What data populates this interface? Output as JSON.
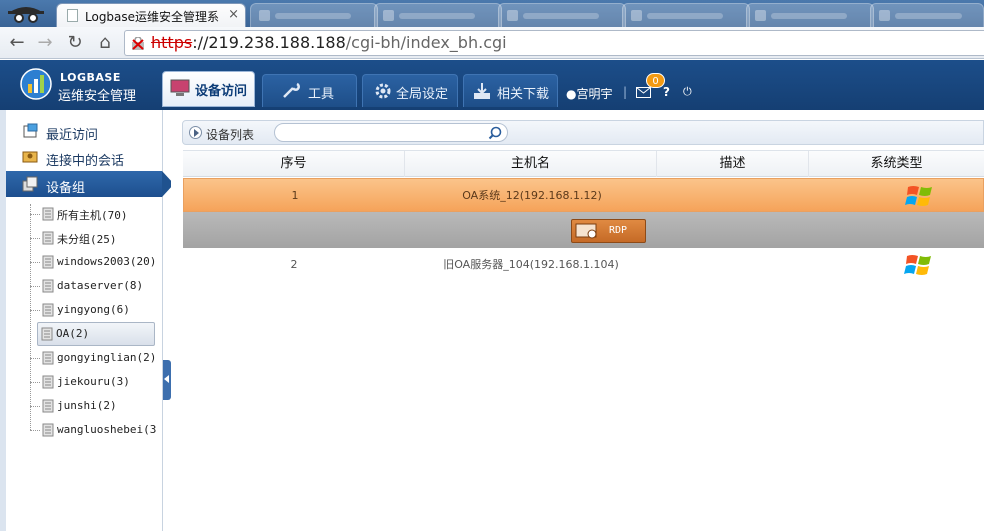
{
  "browser": {
    "active_tab_title": "Logbase运维安全管理系",
    "tab_close": "×",
    "url_scheme": "https",
    "url_sep": "://",
    "url_host": "219.238.188.188",
    "url_path": "/cgi-bh/index_bh.cgi",
    "nav": {
      "back": "←",
      "forward": "→",
      "reload": "↻",
      "home": "⌂"
    }
  },
  "app": {
    "logo_name": "LOGBASE",
    "logo_sub": "运维安全管理",
    "tabs": [
      {
        "label": "设备访问",
        "icon": "monitor-icon"
      },
      {
        "label": "工具",
        "icon": "wrench-icon"
      },
      {
        "label": "全局设定",
        "icon": "gear-icon"
      },
      {
        "label": "相关下载",
        "icon": "download-icon"
      }
    ],
    "user": "宫明宇",
    "separator": "|",
    "mail_badge": "0",
    "help": "?",
    "logout": "⏻"
  },
  "sidebar": {
    "items": [
      {
        "label": "最近访问"
      },
      {
        "label": "连接中的会话"
      },
      {
        "label": "设备组"
      }
    ],
    "tree": [
      "所有主机(70)",
      "未分组(25)",
      "windows2003(20)",
      "dataserver(8)",
      "yingyong(6)",
      "OA(2)",
      "gongyinglian(2)",
      "jiekouru(3)",
      "junshi(2)",
      "wangluoshebei(3"
    ],
    "selected_index": 5
  },
  "content": {
    "breadcrumb": "设备列表",
    "search_placeholder": "",
    "columns": [
      "序号",
      "主机名",
      "描述",
      "系统类型"
    ],
    "rows": [
      {
        "index": "1",
        "host": "OA系统_12(192.168.1.12)",
        "desc": "",
        "os": "windows"
      },
      {
        "index": "2",
        "host": "旧OA服务器_104(192.168.1.104)",
        "desc": "",
        "os": "windows"
      }
    ],
    "rdp_label": "RDP"
  }
}
